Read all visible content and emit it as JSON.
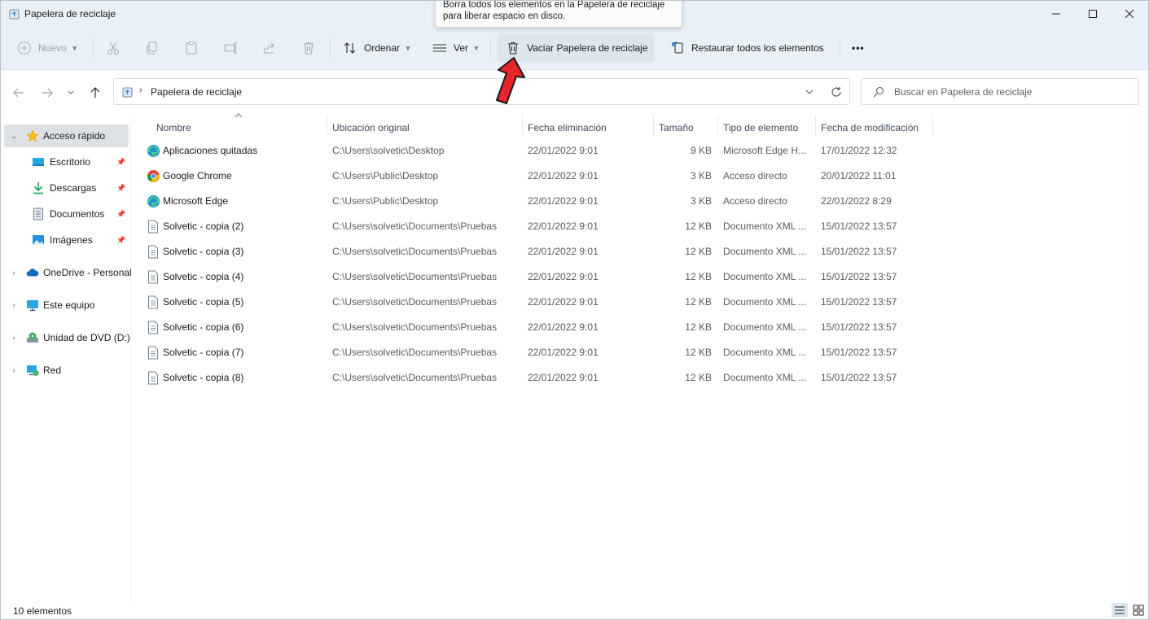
{
  "window": {
    "title": "Papelera de reciclaje"
  },
  "tooltip": {
    "line1": "Borra todos los elementos en la Papelera de reciclaje",
    "line2": "para liberar espacio en disco."
  },
  "toolbar": {
    "new_label": "Nuevo",
    "sort_label": "Ordenar",
    "view_label": "Ver",
    "empty_label": "Vaciar Papelera de reciclaje",
    "restore_label": "Restaurar todos los elementos",
    "more_label": "•••"
  },
  "address": {
    "path": "Papelera de reciclaje"
  },
  "search": {
    "placeholder": "Buscar en Papelera de reciclaje"
  },
  "sidebar": {
    "quick_access": "Acceso rápido",
    "items": [
      {
        "label": "Escritorio"
      },
      {
        "label": "Descargas"
      },
      {
        "label": "Documentos"
      },
      {
        "label": "Imágenes"
      }
    ],
    "onedrive": "OneDrive - Personal",
    "this_pc": "Este equipo",
    "dvd": "Unidad de DVD (D:)",
    "network": "Red"
  },
  "columns": {
    "name": "Nombre",
    "original": "Ubicación original",
    "deleted": "Fecha eliminación",
    "size": "Tamaño",
    "type": "Tipo de elemento",
    "modified": "Fecha de modificación"
  },
  "files": [
    {
      "name": "Aplicaciones quitadas",
      "original": "C:\\Users\\solvetic\\Desktop",
      "deleted": "22/01/2022 9:01",
      "size": "9 KB",
      "type": "Microsoft Edge H...",
      "modified": "17/01/2022 12:32",
      "icon": "edge-icon"
    },
    {
      "name": "Google Chrome",
      "original": "C:\\Users\\Public\\Desktop",
      "deleted": "22/01/2022 9:01",
      "size": "3 KB",
      "type": "Acceso directo",
      "modified": "20/01/2022 11:01",
      "icon": "chrome-icon"
    },
    {
      "name": "Microsoft Edge",
      "original": "C:\\Users\\Public\\Desktop",
      "deleted": "22/01/2022 9:01",
      "size": "3 KB",
      "type": "Acceso directo",
      "modified": "22/01/2022 8:29",
      "icon": "edge-icon"
    },
    {
      "name": "Solvetic - copia (2)",
      "original": "C:\\Users\\solvetic\\Documents\\Pruebas",
      "deleted": "22/01/2022 9:01",
      "size": "12 KB",
      "type": "Documento XML ...",
      "modified": "15/01/2022 13:57",
      "icon": "document-icon"
    },
    {
      "name": "Solvetic - copia (3)",
      "original": "C:\\Users\\solvetic\\Documents\\Pruebas",
      "deleted": "22/01/2022 9:01",
      "size": "12 KB",
      "type": "Documento XML ...",
      "modified": "15/01/2022 13:57",
      "icon": "document-icon"
    },
    {
      "name": "Solvetic - copia (4)",
      "original": "C:\\Users\\solvetic\\Documents\\Pruebas",
      "deleted": "22/01/2022 9:01",
      "size": "12 KB",
      "type": "Documento XML ...",
      "modified": "15/01/2022 13:57",
      "icon": "document-icon"
    },
    {
      "name": "Solvetic - copia (5)",
      "original": "C:\\Users\\solvetic\\Documents\\Pruebas",
      "deleted": "22/01/2022 9:01",
      "size": "12 KB",
      "type": "Documento XML ...",
      "modified": "15/01/2022 13:57",
      "icon": "document-icon"
    },
    {
      "name": "Solvetic - copia (6)",
      "original": "C:\\Users\\solvetic\\Documents\\Pruebas",
      "deleted": "22/01/2022 9:01",
      "size": "12 KB",
      "type": "Documento XML ...",
      "modified": "15/01/2022 13:57",
      "icon": "document-icon"
    },
    {
      "name": "Solvetic - copia (7)",
      "original": "C:\\Users\\solvetic\\Documents\\Pruebas",
      "deleted": "22/01/2022 9:01",
      "size": "12 KB",
      "type": "Documento XML ...",
      "modified": "15/01/2022 13:57",
      "icon": "document-icon"
    },
    {
      "name": "Solvetic - copia (8)",
      "original": "C:\\Users\\solvetic\\Documents\\Pruebas",
      "deleted": "22/01/2022 9:01",
      "size": "12 KB",
      "type": "Documento XML ...",
      "modified": "15/01/2022 13:57",
      "icon": "document-icon"
    }
  ],
  "status": {
    "count": "10 elementos"
  },
  "colors": {
    "accent": "#0067c0",
    "chrome_bg": "#e9f0f7",
    "selection": "#dde1e6",
    "arrow": "#e8242c"
  }
}
